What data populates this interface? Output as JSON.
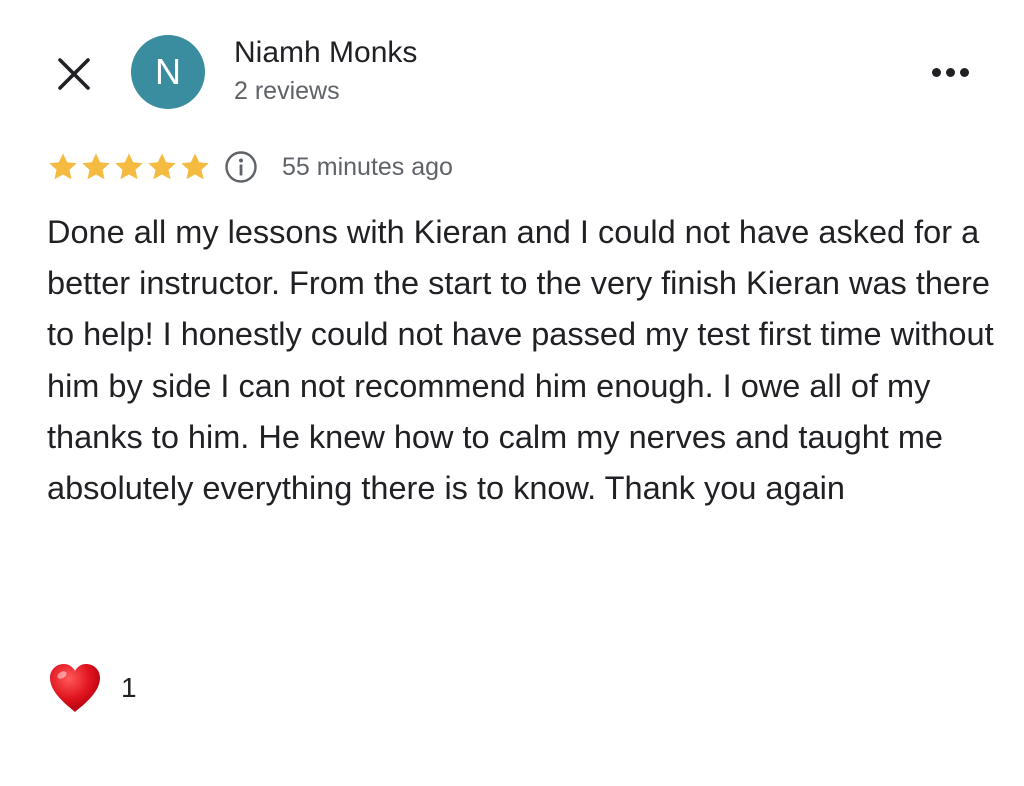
{
  "reviewer": {
    "avatar_letter": "N",
    "avatar_color": "#3a8d9e",
    "name": "Niamh Monks",
    "reviews_count": "2 reviews"
  },
  "rating": {
    "stars": 5,
    "max_stars": 5,
    "star_color": "#f5bb41",
    "time_ago": "55 minutes ago"
  },
  "review": {
    "text": "Done all my lessons with Kieran and I could not have asked for a better instructor. From the start to the very finish Kieran was there to help! I honestly could not have passed my test first time without him by side I can not recommend him enough. I owe all of my thanks to him. He knew how to calm my nerves and taught me absolutely everything there is to know. Thank you again"
  },
  "reactions": {
    "icon": "heart-icon",
    "count": "1"
  },
  "icons": {
    "close": "close-icon",
    "more": "more-options-icon",
    "info": "info-icon"
  }
}
